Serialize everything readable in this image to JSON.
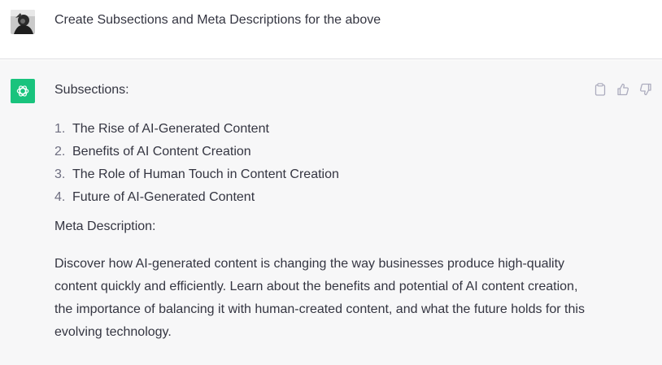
{
  "user_message": {
    "text": "Create Subsections and Meta Descriptions for the above",
    "avatar_icon": "user-photo-avatar"
  },
  "assistant_message": {
    "avatar_icon": "openai-logo-icon",
    "avatar_color": "#19c37d",
    "heading": "Subsections:",
    "items": [
      {
        "num": "1.",
        "text": "The Rise of AI-Generated Content"
      },
      {
        "num": "2.",
        "text": "Benefits of AI Content Creation"
      },
      {
        "num": "3.",
        "text": "The Role of Human Touch in Content Creation"
      },
      {
        "num": "4.",
        "text": "Future of AI-Generated Content"
      }
    ],
    "meta_heading": "Meta Description:",
    "meta_body": "Discover how AI-generated content is changing the way businesses produce high-quality content quickly and efficiently. Learn about the benefits and potential of AI content creation, the importance of balancing it with human-created content, and what the future holds for this evolving technology."
  },
  "actions": {
    "copy_icon": "clipboard-icon",
    "like_icon": "thumbs-up-icon",
    "dislike_icon": "thumbs-down-icon"
  }
}
